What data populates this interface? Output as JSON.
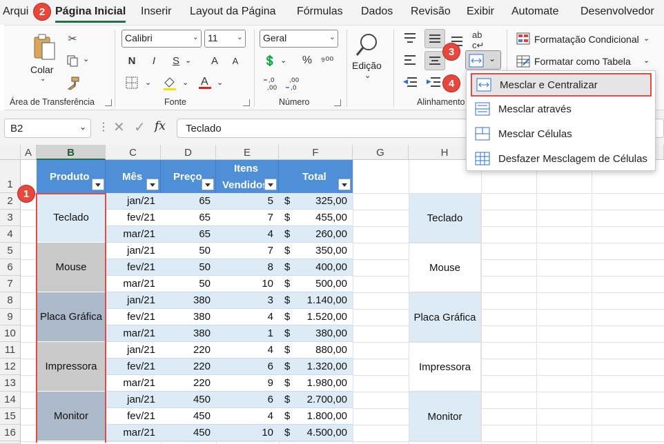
{
  "tabs": [
    "Arqui",
    "Página Inicial",
    "Inserir",
    "Layout da Página",
    "Fórmulas",
    "Dados",
    "Revisão",
    "Exibir",
    "Automate",
    "Desenvolvedor"
  ],
  "ribbon": {
    "clipboard": {
      "paste_label": "Colar",
      "group_label": "Área de Transferência"
    },
    "font": {
      "name": "Calibri",
      "size": "11",
      "bold": "N",
      "italic": "I",
      "underline": "S",
      "grow": "A",
      "shrink": "A",
      "group_label": "Fonte"
    },
    "number": {
      "format": "Geral",
      "group_label": "Número"
    },
    "editing": {
      "label": "Edição"
    },
    "alignment": {
      "group_label": "Alinhamento"
    },
    "styles": {
      "conditional": "Formatação Condicional",
      "table": "Formatar como Tabela"
    }
  },
  "formula_bar": {
    "name_box": "B2",
    "fx": "fx",
    "value": "Teclado"
  },
  "columns": [
    "A",
    "B",
    "C",
    "D",
    "E",
    "F",
    "G",
    "H"
  ],
  "rows": [
    "1",
    "2",
    "3",
    "4",
    "5",
    "6",
    "7",
    "8",
    "9",
    "10",
    "11",
    "12",
    "13",
    "14",
    "15",
    "16"
  ],
  "table": {
    "headers": [
      "Produto",
      "Mês",
      "Preço",
      "Itens",
      "Vendidos",
      "Total"
    ],
    "merged": [
      "Teclado",
      "Mouse",
      "Placa Gráfica",
      "Impressora",
      "Monitor"
    ],
    "months": [
      "jan/21",
      "fev/21",
      "mar/21",
      "jan/21",
      "fev/21",
      "mar/21",
      "jan/21",
      "fev/21",
      "mar/21",
      "jan/21",
      "fev/21",
      "mar/21",
      "jan/21",
      "fev/21",
      "mar/21"
    ],
    "prices": [
      "65",
      "65",
      "65",
      "50",
      "50",
      "50",
      "380",
      "380",
      "380",
      "220",
      "220",
      "220",
      "450",
      "450",
      "450"
    ],
    "items": [
      "5",
      "7",
      "4",
      "7",
      "8",
      "10",
      "3",
      "4",
      "1",
      "4",
      "6",
      "9",
      "6",
      "4",
      "10"
    ],
    "currency": "$",
    "totals": [
      "325,00",
      "455,00",
      "260,00",
      "350,00",
      "400,00",
      "500,00",
      "1.140,00",
      "1.520,00",
      "380,00",
      "880,00",
      "1.320,00",
      "1.980,00",
      "2.700,00",
      "1.800,00",
      "4.500,00"
    ]
  },
  "column_h": [
    "Teclado",
    "Mouse",
    "Placa Gráfica",
    "Impressora",
    "Monitor"
  ],
  "menu": {
    "items": [
      "Mesclar e Centralizar",
      "Mesclar através",
      "Mesclar Células",
      "Desfazer Mesclagem de Células"
    ]
  },
  "badges": [
    "1",
    "2",
    "3",
    "4"
  ],
  "colors": {
    "header_blue": "#4f8fd8",
    "band_blue": "#ddebf7",
    "merge_gray": "#c9c9c9",
    "badge_red": "#e8473c",
    "excel_green": "#217346"
  }
}
